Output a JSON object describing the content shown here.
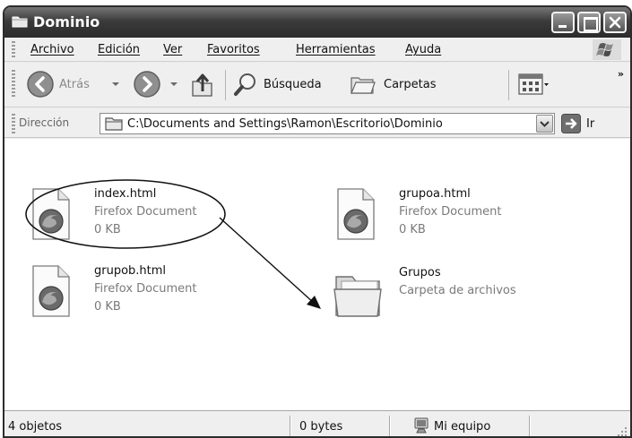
{
  "window": {
    "title": "Dominio"
  },
  "menubar": {
    "items": [
      {
        "label": "Archivo"
      },
      {
        "label": "Edición"
      },
      {
        "label": "Ver"
      },
      {
        "label": "Favoritos"
      },
      {
        "label": "Herramientas"
      },
      {
        "label": "Ayuda"
      }
    ]
  },
  "toolbar": {
    "back_label": "Atrás",
    "search_label": "Búsqueda",
    "folders_label": "Carpetas",
    "overflow": "»"
  },
  "addressbar": {
    "label": "Dirección",
    "path": "C:\\Documents and Settings\\Ramon\\Escritorio\\Dominio",
    "go_label": "Ir"
  },
  "files": [
    {
      "name": "index.html",
      "type": "Firefox Document",
      "size": "0 KB"
    },
    {
      "name": "grupoa.html",
      "type": "Firefox Document",
      "size": "0 KB"
    },
    {
      "name": "grupob.html",
      "type": "Firefox Document",
      "size": "0 KB"
    },
    {
      "name": "Grupos",
      "type": "Carpeta de archivos"
    }
  ],
  "statusbar": {
    "objects": "4 objetos",
    "bytes": "0 bytes",
    "location": "Mi equipo"
  }
}
